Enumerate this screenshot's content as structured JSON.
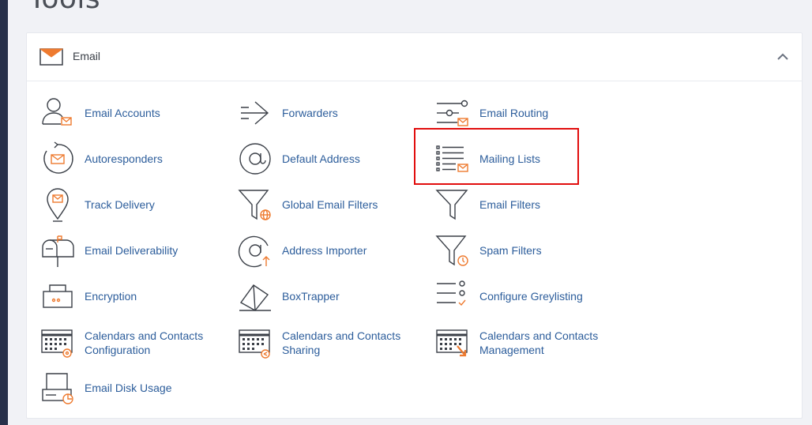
{
  "page": {
    "heading": "Tools"
  },
  "panel": {
    "title": "Email"
  },
  "colors": {
    "accent": "#ee7a2f",
    "link": "#2c5d9b",
    "highlight": "#e10d0d"
  },
  "tools": [
    {
      "label": "Email Accounts",
      "icon": "user-envelope-icon"
    },
    {
      "label": "Forwarders",
      "icon": "forward-arrow-icon"
    },
    {
      "label": "Email Routing",
      "icon": "routing-icon"
    },
    {
      "label": "Autoresponders",
      "icon": "autoresponder-icon"
    },
    {
      "label": "Default Address",
      "icon": "at-sign-icon"
    },
    {
      "label": "Mailing Lists",
      "icon": "list-envelope-icon"
    },
    {
      "label": "Track Delivery",
      "icon": "location-pin-icon"
    },
    {
      "label": "Global Email Filters",
      "icon": "funnel-globe-icon"
    },
    {
      "label": "Email Filters",
      "icon": "funnel-icon"
    },
    {
      "label": "Email Deliverability",
      "icon": "mailbox-icon"
    },
    {
      "label": "Address Importer",
      "icon": "at-import-icon"
    },
    {
      "label": "Spam Filters",
      "icon": "funnel-clock-icon"
    },
    {
      "label": "Encryption",
      "icon": "lock-box-icon"
    },
    {
      "label": "BoxTrapper",
      "icon": "box-trap-icon"
    },
    {
      "label": "Configure Greylisting",
      "icon": "checklist-icon"
    },
    {
      "label": "Calendars and Contacts Configuration",
      "icon": "calendar-gear-icon"
    },
    {
      "label": "Calendars and Contacts Sharing",
      "icon": "calendar-share-icon"
    },
    {
      "label": "Calendars and Contacts Management",
      "icon": "calendar-manage-icon"
    },
    {
      "label": "Email Disk Usage",
      "icon": "disk-usage-icon"
    }
  ]
}
